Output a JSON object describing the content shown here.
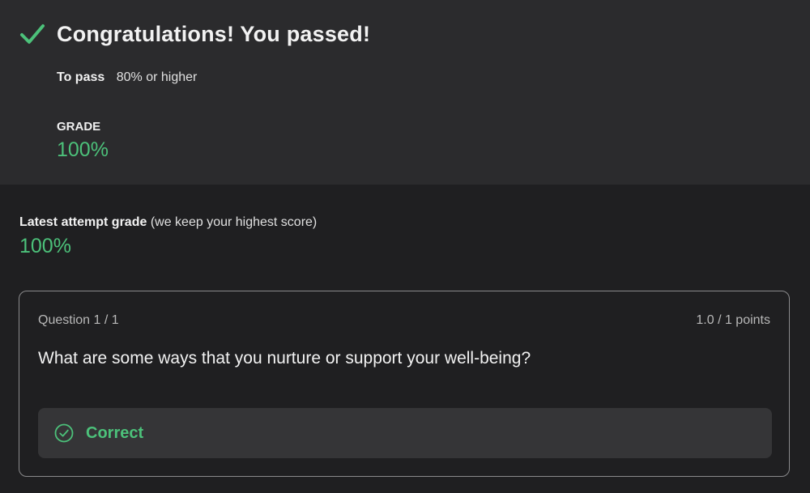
{
  "summary": {
    "title": "Congratulations! You passed!",
    "to_pass_label": "To pass",
    "to_pass_value": "80% or higher",
    "grade_label": "GRADE",
    "grade_value": "100%"
  },
  "latest": {
    "label": "Latest attempt grade",
    "note": "(we keep your highest score)",
    "value": "100%"
  },
  "question": {
    "number": "Question 1 / 1",
    "points": "1.0 / 1 points",
    "text": "What are some ways that you nurture or support your well-being?",
    "result": "Correct",
    "result_icon": "check-circle-icon"
  },
  "colors": {
    "accent_green": "#4cc17a",
    "panel_bg": "#2b2b2d",
    "page_bg": "#1f1f21"
  }
}
